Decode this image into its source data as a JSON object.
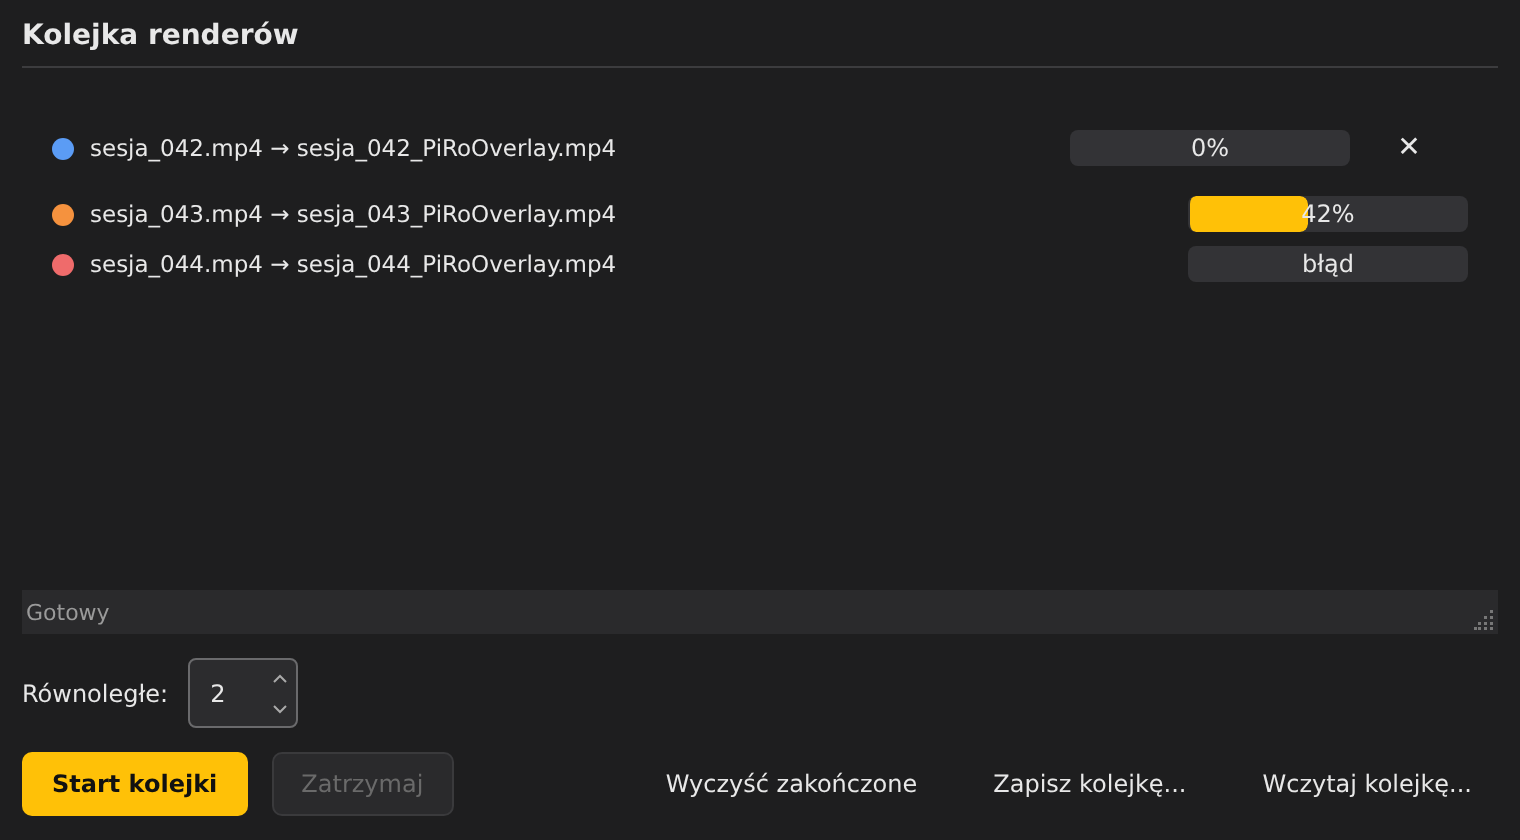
{
  "title": "Kolejka renderów",
  "jobs": [
    {
      "name": "sesja_042.mp4 → sesja_042_PiRoOverlay.mp4",
      "color": "#5b9cf5",
      "level": 0,
      "reading": "0%",
      "removable": true
    },
    {
      "name": "sesja_043.mp4 → sesja_043_PiRoOverlay.mp4",
      "color": "#f5923e",
      "level": 0.42,
      "reading": "42%",
      "removable": false
    },
    {
      "name": "sesja_044.mp4 → sesja_044_PiRoOverlay.mp4",
      "color": "#ef6b6b",
      "reading": "błąd",
      "removable": false
    }
  ],
  "remove_symbol": "✕",
  "status_bar": "Gotowy",
  "parallel": {
    "label": "Równoległe:",
    "value": "2"
  },
  "buttons": [
    {
      "label": "Start kolejki",
      "kind": "primary",
      "disabled": false
    },
    {
      "label": "Zatrzymaj",
      "kind": "secondary",
      "disabled": true
    },
    {
      "label": "Wyczyść zakończone",
      "kind": "flat",
      "disabled": false
    },
    {
      "label": "Zapisz kolejkę...",
      "kind": "flat",
      "disabled": false
    },
    {
      "label": "Wczytaj kolejkę...",
      "kind": "flat",
      "disabled": false
    }
  ]
}
